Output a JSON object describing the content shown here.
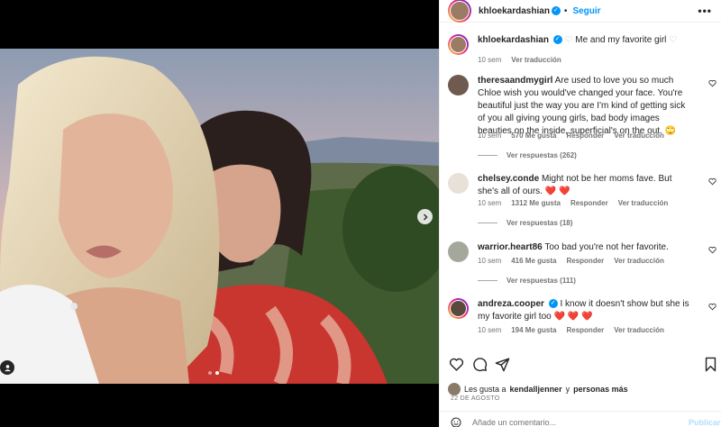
{
  "post": {
    "author": "khloekardashian",
    "follow_label": "Seguir",
    "dot": "•",
    "caption": "Me and my favorite girl",
    "caption_time": "10 sem",
    "see_translation": "Ver traducción",
    "carousel": {
      "current_index": 2,
      "total": 2
    }
  },
  "comments": [
    {
      "user": "theresaandmygirl",
      "text": "Are used to love you so much Chloe wish you would've changed your face. You're beautiful just the way you are I'm kind of getting sick of you all giving young girls, bad body images beauties on the inside, superficial's on the out. 🙄",
      "time": "10 sem",
      "likes": "570 Me gusta",
      "reply": "Responder",
      "translate": "Ver traducción",
      "view_replies": "Ver respuestas (262)"
    },
    {
      "user": "chelsey.conde",
      "text": "Might not be her moms fave. But she's all of ours.",
      "hearts": "❤️ ❤️",
      "time": "10 sem",
      "likes": "1312 Me gusta",
      "reply": "Responder",
      "translate": "Ver traducción",
      "view_replies": "Ver respuestas (18)"
    },
    {
      "user": "warrior.heart86",
      "text": "Too bad you're not her favorite.",
      "time": "10 sem",
      "likes": "416 Me gusta",
      "reply": "Responder",
      "translate": "Ver traducción",
      "view_replies": "Ver respuestas (111)"
    },
    {
      "user": "andreza.cooper",
      "text": "I know it doesn't show but she is my favorite girl too",
      "hearts": "❤️ ❤️ ❤️",
      "time": "10 sem",
      "likes": "194 Me gusta",
      "reply": "Responder",
      "translate": "Ver traducción"
    }
  ],
  "likes_line": {
    "prefix": "Les gusta a",
    "user": "kendalljenner",
    "conj": "y",
    "others": "personas más"
  },
  "date": "22 DE AGOSTO",
  "add_comment": {
    "placeholder": "Añade un comentario...",
    "post_label": "Publicar"
  },
  "icons": {
    "heart": "heart-icon",
    "comment": "comment-icon",
    "share": "share-icon",
    "save": "bookmark-icon",
    "more": "more-options-icon",
    "emoji": "emoji-icon",
    "next": "chevron-right-icon",
    "tag": "user-tag-icon"
  },
  "colors": {
    "accent": "#0095f6",
    "verified": "#0095f6",
    "like_red": "#ed4956",
    "muted": "#737373"
  }
}
